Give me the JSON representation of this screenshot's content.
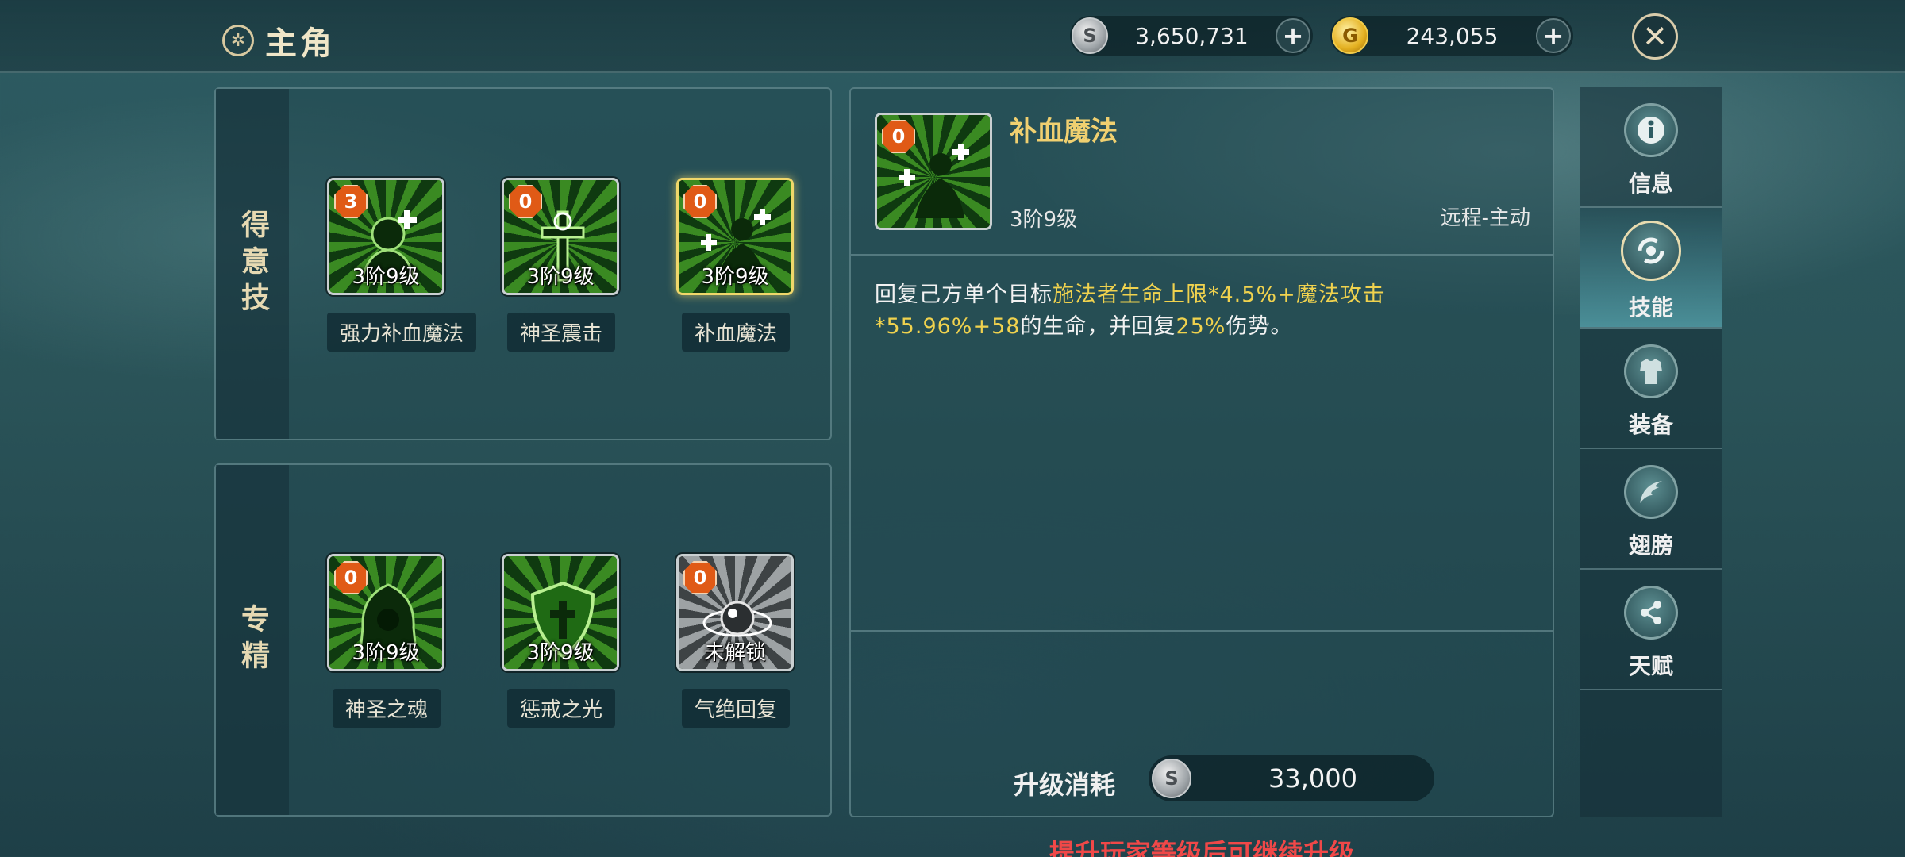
{
  "header": {
    "title": "主角",
    "currencies": [
      {
        "type": "silver",
        "value": "3,650,731",
        "icon": "silver-coin-icon"
      },
      {
        "type": "gold",
        "value": "243,055",
        "icon": "gold-coin-icon"
      }
    ]
  },
  "featured_skills": {
    "label": "得意技",
    "items": [
      {
        "name": "强力补血魔法",
        "badge": "3",
        "level": "3阶9级",
        "icon": "heal-hood-icon"
      },
      {
        "name": "神圣震击",
        "badge": "0",
        "level": "3阶9级",
        "icon": "holy-cross-icon"
      },
      {
        "name": "补血魔法",
        "badge": "0",
        "level": "3阶9级",
        "icon": "heal-figure-icon",
        "selected": true
      }
    ]
  },
  "mastery_skills": {
    "label": "专精",
    "items": [
      {
        "name": "神圣之魂",
        "badge": "0",
        "level": "3阶9级",
        "icon": "holy-soul-icon"
      },
      {
        "name": "惩戒之光",
        "badge": "",
        "level": "3阶9级",
        "icon": "shield-cross-icon"
      },
      {
        "name": "气绝回复",
        "badge": "0",
        "level": "未解锁",
        "icon": "orb-ring-icon",
        "locked": true
      }
    ]
  },
  "detail": {
    "name": "补血魔法",
    "badge": "0",
    "level": "3阶9级",
    "type": "远程-主动",
    "desc_1": "回复己方单个目标",
    "desc_2": "施法者生命上限*4.5%+魔法攻击*55.96%+58",
    "desc_3": "的生命，并回复",
    "desc_4": "25%",
    "desc_5": "伤势。",
    "cost_label": "升级消耗",
    "cost_value": "33,000",
    "warning": "提升玩家等级后可继续升级"
  },
  "tabs": [
    {
      "label": "信息",
      "icon": "info-icon"
    },
    {
      "label": "技能",
      "icon": "skill-icon",
      "active": true
    },
    {
      "label": "装备",
      "icon": "armor-icon"
    },
    {
      "label": "翅膀",
      "icon": "wing-icon"
    },
    {
      "label": "天赋",
      "icon": "share-icon"
    }
  ],
  "colors": {
    "accent_gold": "#f0d070",
    "highlight": "#f0d24e",
    "warning": "#f04848",
    "badge": "#e05a16"
  }
}
